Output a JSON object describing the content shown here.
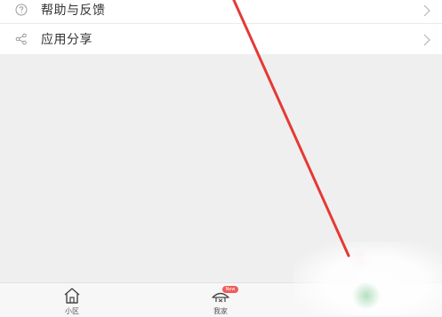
{
  "menu": {
    "items": [
      {
        "label": "帮助与反馈",
        "icon": "help-circle-icon"
      },
      {
        "label": "应用分享",
        "icon": "share-icon"
      }
    ]
  },
  "tabbar": {
    "tabs": [
      {
        "label": "小区",
        "icon": "home-icon"
      },
      {
        "label": "我家",
        "icon": "house-roof-icon",
        "badge": "New"
      }
    ]
  },
  "colors": {
    "background": "#efefef",
    "card": "#ffffff",
    "annotation_line": "#e53935",
    "badge": "#f25b5b"
  }
}
